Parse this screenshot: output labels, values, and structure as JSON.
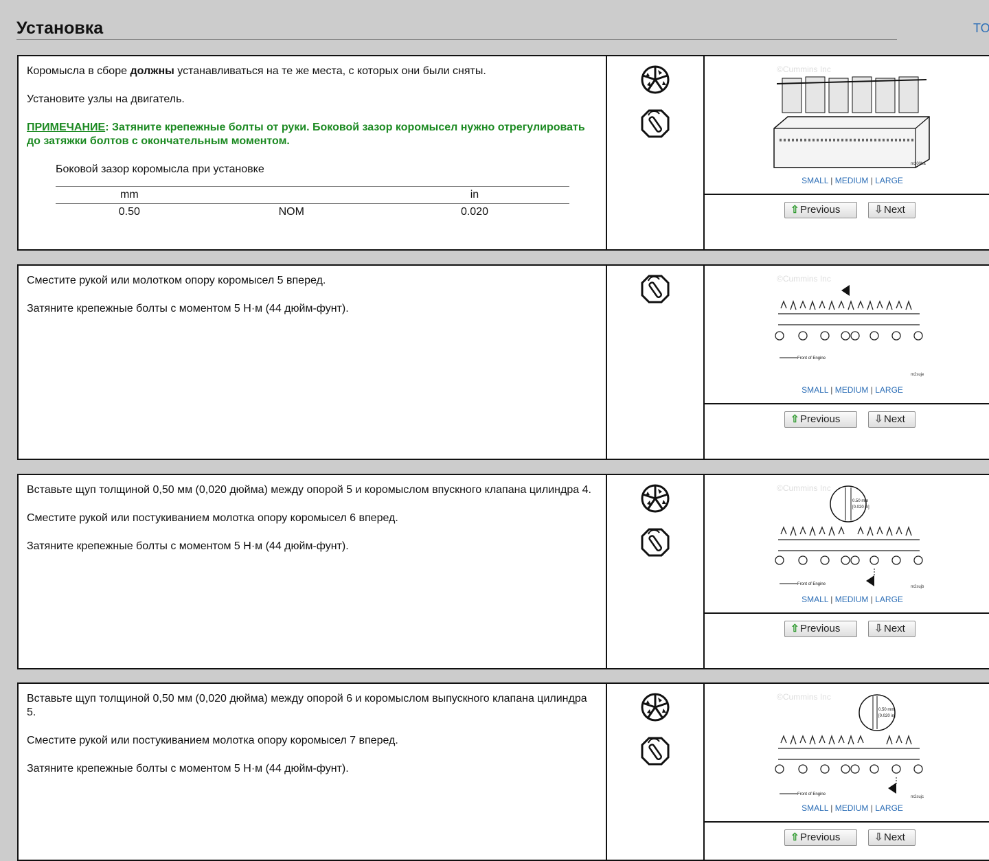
{
  "page": {
    "title": "Установка",
    "top_link": "TO"
  },
  "steps": [
    {
      "paragraphs": [
        "Коромысла в сборе ",
        "должны",
        " устанавливаться на те же места, с которых они были сняты.",
        "Установите узлы на двигатель."
      ],
      "note_label": "ПРИМЕЧАНИЕ",
      "note_text": ": Затяните крепежные болты от руки. Боковой зазор коромысел нужно отрегулировать до затяжки болтов с окончательным моментом.",
      "spec_caption": "Боковой зазор коромысла при установке",
      "spec_headers": [
        "mm",
        "",
        "in"
      ],
      "spec_row": [
        "0.50",
        "NOM",
        "0.020"
      ],
      "icons": [
        "tool-set-icon",
        "torque-wrench-icon"
      ],
      "figure": {
        "watermark": "©Cummins Inc",
        "code": "m200ha"
      }
    },
    {
      "paragraphs": [
        "Сместите рукой или молотком опору коромысел 5 вперед.",
        "Затяните крепежные болты с моментом 5 Н·м (44 дюйм-фунт)."
      ],
      "icons": [
        "torque-wrench-icon"
      ],
      "figure": {
        "watermark": "©Cummins Inc",
        "caption": "Front of Engine",
        "code": "m2suje"
      }
    },
    {
      "paragraphs": [
        "Вставьте щуп толщиной 0,50 мм (0,020 дюйма) между опорой 5 и коромыслом впускного клапана цилиндра 4.",
        "Сместите рукой или постукиванием молотка опору коромысел 6 вперед.",
        "Затяните крепежные болты с моментом 5 Н·м (44 дюйм-фунт)."
      ],
      "icons": [
        "tool-set-icon",
        "torque-wrench-icon"
      ],
      "figure": {
        "watermark": "©Cummins Inc",
        "caption": "Front of Engine",
        "code": "m2sujb",
        "callout": [
          "0.50 mm",
          "[0.020 in]"
        ]
      }
    },
    {
      "paragraphs": [
        "Вставьте щуп толщиной 0,50 мм (0,020 дюйма) между опорой 6 и коромыслом выпускного клапана цилиндра 5.",
        "Сместите рукой или постукиванием молотка опору коромысел 7 вперед.",
        "Затяните крепежные болты с моментом 5 Н·м (44 дюйм-фунт)."
      ],
      "icons": [
        "tool-set-icon",
        "torque-wrench-icon"
      ],
      "figure": {
        "watermark": "©Cummins Inc",
        "caption": "Front of Engine",
        "code": "m2sujc",
        "callout": [
          "0.50 mm",
          "[0.020 in]"
        ]
      }
    }
  ],
  "figure_links": {
    "small": "SMALL",
    "medium": "MEDIUM",
    "large": "LARGE",
    "sep": " | "
  },
  "nav": {
    "previous": "Previous",
    "next": "Next"
  },
  "colors": {
    "background": "#cccccc",
    "note": "#1c8a22",
    "link": "#2e6fb7"
  }
}
